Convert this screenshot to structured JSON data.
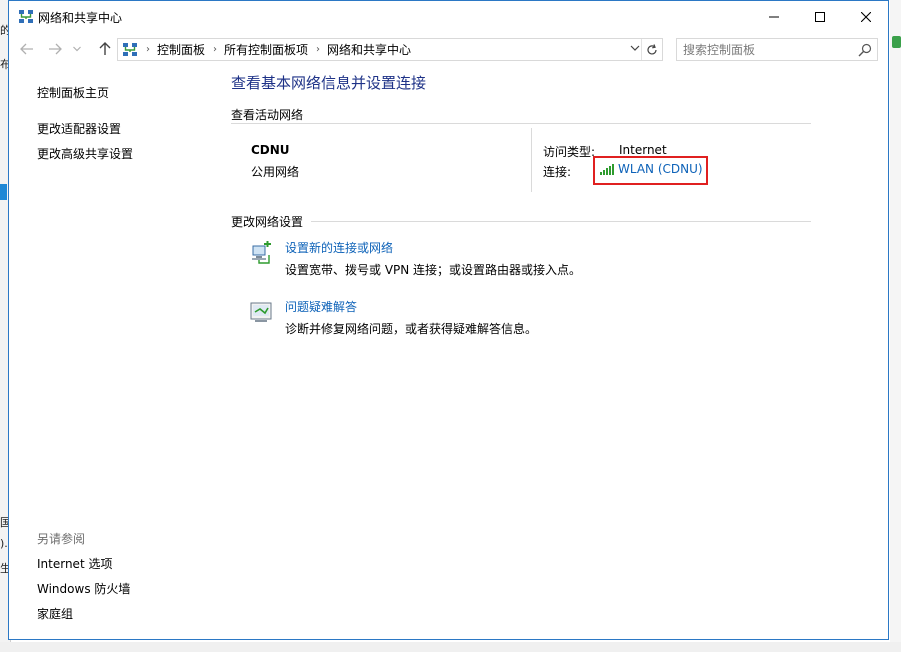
{
  "background": {
    "left_fragments": [
      "的",
      "布",
      "国",
      ").",
      "生"
    ]
  },
  "window": {
    "title": "网络和共享中心",
    "controls": {
      "minimize": "minimize-icon",
      "maximize": "maximize-icon",
      "close": "close-icon"
    }
  },
  "address": {
    "breadcrumbs": [
      "控制面板",
      "所有控制面板项",
      "网络和共享中心"
    ]
  },
  "search": {
    "placeholder": "搜索控制面板"
  },
  "sidebar": {
    "home": "控制面板主页",
    "links": [
      "更改适配器设置",
      "更改高级共享设置"
    ],
    "see_also_heading": "另请参阅",
    "see_also": [
      "Internet 选项",
      "Windows 防火墙",
      "家庭组"
    ]
  },
  "main": {
    "title": "查看基本网络信息并设置连接",
    "active_section": "查看活动网络",
    "network": {
      "name": "CDNU",
      "category": "公用网络",
      "access_type_label": "访问类型:",
      "access_type_value": "Internet",
      "connection_label": "连接:",
      "connection_value": "WLAN (CDNU)"
    },
    "change_section": "更改网络设置",
    "tasks": [
      {
        "link": "设置新的连接或网络",
        "desc": "设置宽带、拨号或 VPN 连接；或设置路由器或接入点。",
        "icon": "new-connection-icon"
      },
      {
        "link": "问题疑难解答",
        "desc": "诊断并修复网络问题，或者获得疑难解答信息。",
        "icon": "troubleshoot-icon"
      }
    ]
  },
  "colors": {
    "link": "#0d62b8",
    "title": "#1e3287",
    "highlight_box": "#e02020",
    "window_border": "#2b78c5"
  }
}
